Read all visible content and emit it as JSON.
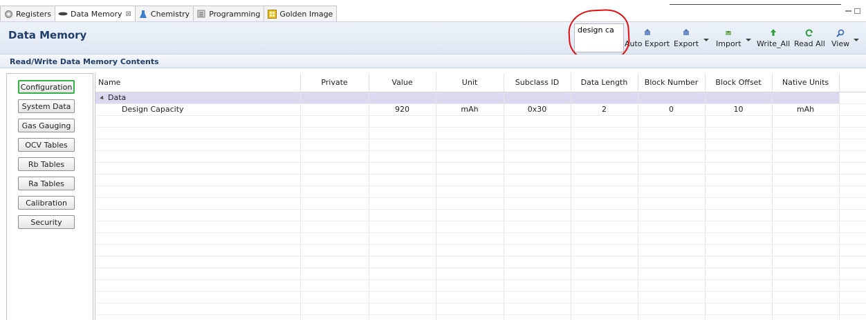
{
  "tabs": [
    {
      "label": "Registers",
      "icon": "gear-icon",
      "active": false
    },
    {
      "label": "Data Memory",
      "icon": "chip-icon",
      "active": true,
      "close": "⊠"
    },
    {
      "label": "Chemistry",
      "icon": "flask-icon",
      "active": false
    },
    {
      "label": "Programming",
      "icon": "programming-icon",
      "active": false
    },
    {
      "label": "Golden Image",
      "icon": "golden-image-icon",
      "active": false
    }
  ],
  "header": {
    "title": "Data Memory",
    "search_value": "design ca"
  },
  "toolbar": {
    "auto_export": "Auto Export",
    "export": "Export",
    "import": "Import",
    "write_all": "Write_All",
    "read_all": "Read All",
    "view": "View"
  },
  "section": {
    "title": "Read/Write Data Memory Contents"
  },
  "categories": [
    "Configuration",
    "System Data",
    "Gas Gauging",
    "OCV Tables",
    "Rb Tables",
    "Ra Tables",
    "Calibration",
    "Security"
  ],
  "table": {
    "columns": [
      "Name",
      "Private",
      "Value",
      "Unit",
      "Subclass ID",
      "Data Length",
      "Block Number",
      "Block Offset",
      "Native Units"
    ],
    "group": "Data",
    "row": {
      "name": "Design Capacity",
      "private": "",
      "value": "920",
      "unit": "mAh",
      "subclass_id": "0x30",
      "data_length": "2",
      "block_number": "0",
      "block_offset": "10",
      "native_units": "mAh"
    }
  },
  "colors": {
    "accent": "#1f3f6a",
    "group_row": "#dcd8f0",
    "active_button_border": "#35b04a",
    "annotation": "#e01010"
  }
}
